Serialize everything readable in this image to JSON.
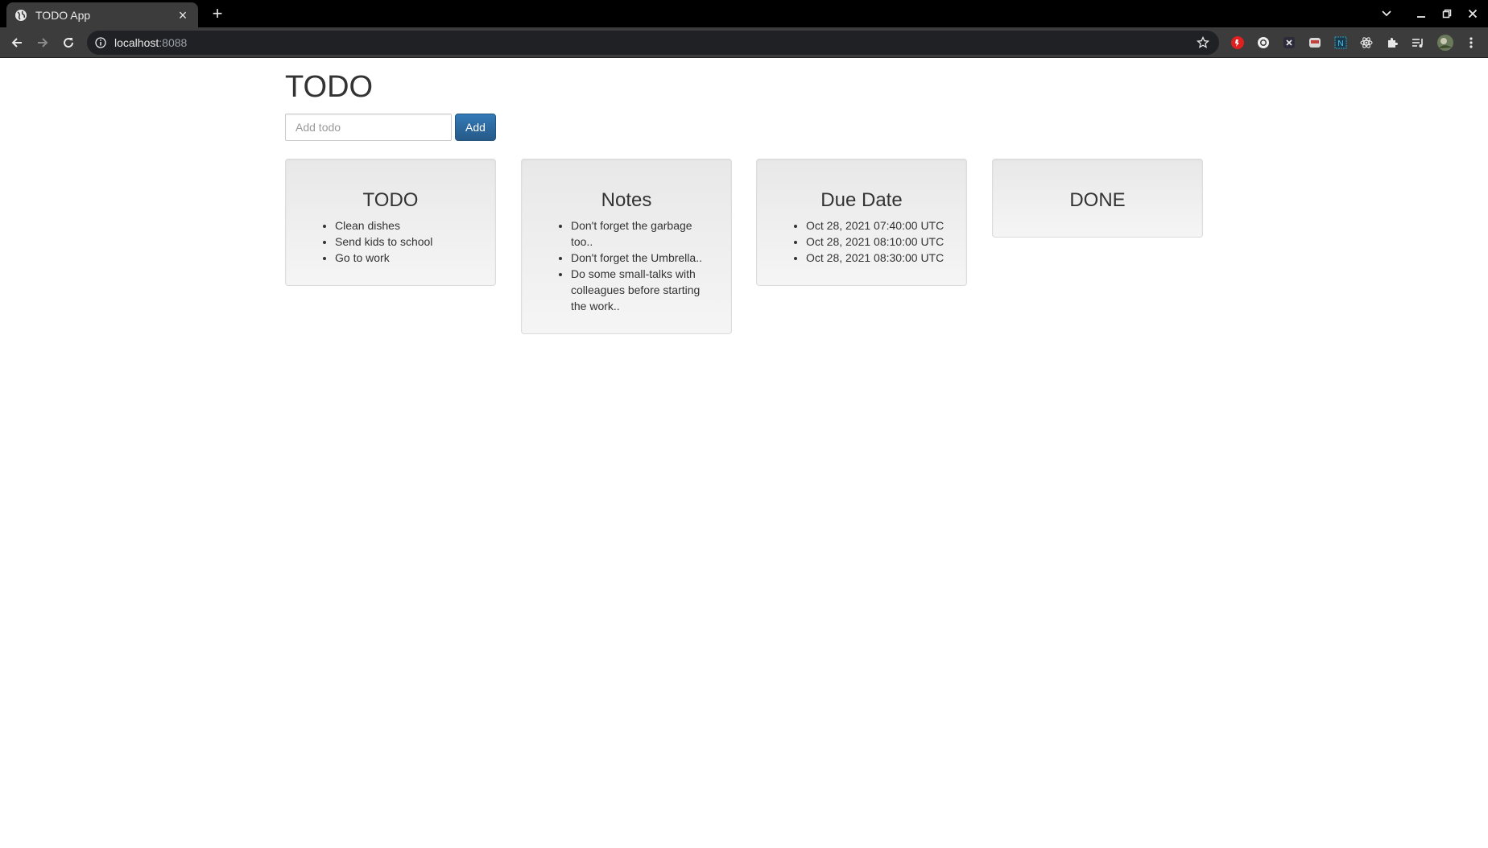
{
  "browser": {
    "tab_title": "TODO App",
    "close_glyph": "×",
    "newtab_glyph": "+",
    "url_host": "localhost",
    "url_port": ":8088"
  },
  "header": {
    "title": "TODO"
  },
  "form": {
    "placeholder": "Add todo",
    "add_label": "Add"
  },
  "columns": [
    {
      "title": "TODO",
      "items": [
        "Clean dishes",
        "Send kids to school",
        "Go to work"
      ]
    },
    {
      "title": "Notes",
      "items": [
        "Don't forget the garbage too..",
        "Don't forget the Umbrella..",
        "Do some small-talks with colleagues before starting the work.."
      ]
    },
    {
      "title": "Due Date",
      "items": [
        "Oct 28, 2021 07:40:00 UTC",
        "Oct 28, 2021 08:10:00 UTC",
        "Oct 28, 2021 08:30:00 UTC"
      ]
    },
    {
      "title": "DONE",
      "items": []
    }
  ]
}
